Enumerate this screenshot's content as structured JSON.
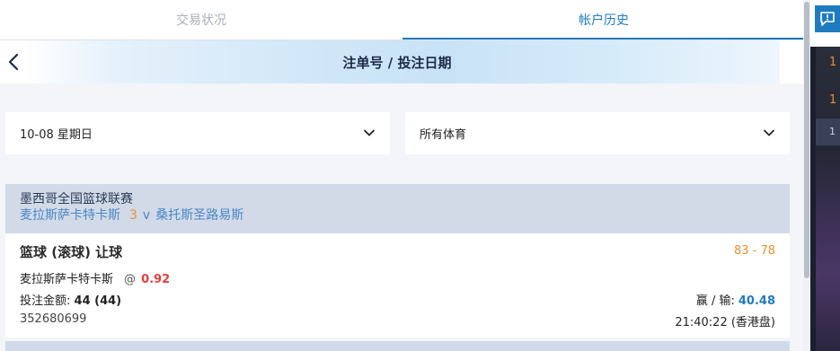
{
  "tabs": [
    {
      "label": "交易状况",
      "active": false
    },
    {
      "label": "帐户历史",
      "active": true
    }
  ],
  "header": {
    "title": "注单号 / 投注日期"
  },
  "filters": {
    "date": "10-08 星期日",
    "sport": "所有体育"
  },
  "bet": {
    "league": "墨西哥全国篮球联赛",
    "home_team": "麦拉斯萨卡特卡斯",
    "live_score_home": "3",
    "vs": "v",
    "away_team": "桑托斯圣路易斯",
    "bet_type": "篮球 (滚球) 让球",
    "final_score": "83 - 78",
    "selection": "麦拉斯萨卡特卡斯",
    "at": "@",
    "odds": "0.92",
    "stake_label": "投注金额:",
    "stake_value": "44 (44)",
    "winloss_label": "赢 / 输:",
    "winloss_value": "40.48",
    "ticket_id": "352680699",
    "time": "21:40:22 (香港盘)"
  },
  "side": {
    "num1": "1",
    "num2": "1",
    "strip": "1"
  },
  "colors": {
    "accent": "#1f7bc0",
    "orange": "#e8912c",
    "odds_red": "#e0413c"
  }
}
